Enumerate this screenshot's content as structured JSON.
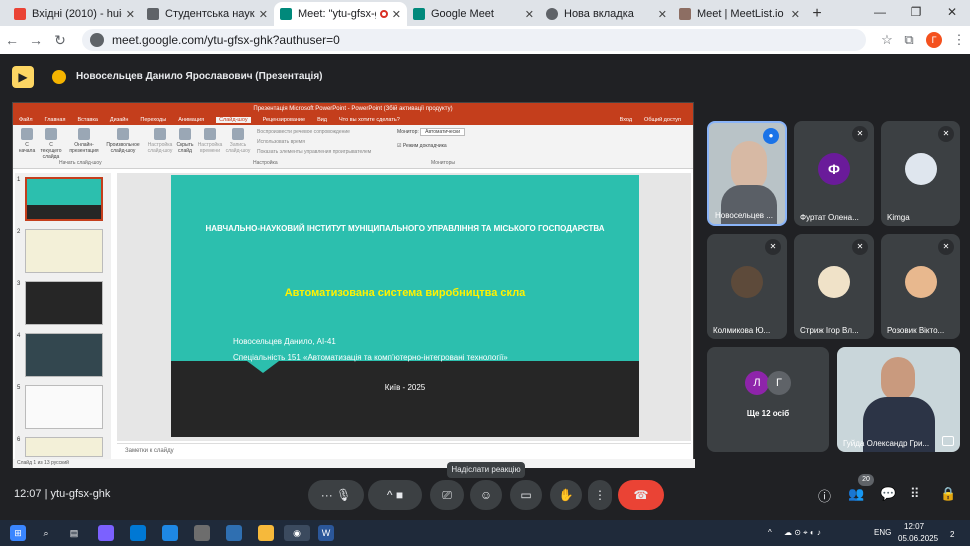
{
  "browser": {
    "tabs": [
      {
        "title": "Вхідні (2010) - huida.oleks",
        "color": "#ea4335",
        "active": false
      },
      {
        "title": "Студентська наукова конф",
        "color": "#5f6368",
        "active": false
      },
      {
        "title": "Meet: \"ytu-gfsx-ghk\"",
        "color": "#00897b",
        "active": true
      },
      {
        "title": "Google Meet",
        "color": "#00897b",
        "active": false
      },
      {
        "title": "Нова вкладка",
        "color": "#5f6368",
        "active": false
      },
      {
        "title": "Meet | MeetList.io",
        "color": "#8d6e63",
        "active": false
      }
    ],
    "url": "meet.google.com/ytu-gfsx-ghk?authuser=0",
    "profile_initial": "Г"
  },
  "meet": {
    "presenter": "Новосельцев Данило Ярославович (Презентація)",
    "meeting_code": "ytu-gfsx-ghk",
    "time": "12:07",
    "tooltip": "Надіслати реакцію",
    "participants_count": "20",
    "tiles": [
      {
        "name": "Новосельцев ...",
        "bg": "#a8b3b8",
        "muted": false
      },
      {
        "name": "Фуртат Олена...",
        "bg": "#3c4043",
        "muted": true,
        "initial": "Ф",
        "avatar_color": "#6a1b9a"
      },
      {
        "name": "Kimga",
        "bg": "#3c4043",
        "muted": true
      },
      {
        "name": "Колмикова Ю...",
        "bg": "#3c4043",
        "muted": true
      },
      {
        "name": "Стриж Ігор Вл...",
        "bg": "#3c4043",
        "muted": true
      },
      {
        "name": "Розовик Вікто...",
        "bg": "#3c4043",
        "muted": true
      }
    ],
    "others": {
      "label": "Ще 12 осіб",
      "initials": [
        "Л",
        "Г"
      ]
    },
    "last_tile_name": "Гуйда Олександр Гри..."
  },
  "ppt": {
    "window_title": "Презентація Microsoft PowerPoint - PowerPoint (Збій активації продукту)",
    "menu": [
      "Файл",
      "Главная",
      "Вставка",
      "Дизайн",
      "Переходы",
      "Анимация",
      "Слайд-шоу",
      "Рецензирование",
      "Вид",
      "Что вы хотите сделать?"
    ],
    "menu_right": [
      "Вход",
      "Общий доступ"
    ],
    "ribbon_buttons": [
      "С начала",
      "С текущего слайда",
      "Онлайн-презентация",
      "Произвольное слайд-шоу",
      "Настройка слайд-шоу",
      "Скрыть слайд",
      "Настройка времени",
      "Запись слайд-шоу"
    ],
    "ribbon_checks": [
      "Воспроизвести речевое сопровождение",
      "Использовать время",
      "Показать элементы управления проигрывателем"
    ],
    "ribbon_monitor": [
      "Монитор:",
      "Автоматически",
      "Режим докладчика"
    ],
    "groups": [
      "Начать слайд-шоу",
      "Настройка",
      "Мониторы"
    ],
    "slide": {
      "institute": "НАВЧАЛЬНО-НАУКОВИЙ ІНСТИТУТ МУНІЦИПАЛЬНОГО УПРАВЛІННЯ ТА МІСЬКОГО ГОСПОДАРСТВА",
      "title": "Автоматизована система виробництва скла",
      "author": "Новосельцев Данило, АІ-41",
      "specialty": "Спеціальність 151 «Автоматизація та комп’ютерно-інтегровані технології»",
      "city": "Київ - 2025"
    },
    "notes": "Заметки к слайду",
    "status": "Слайд 1 из 13    русский",
    "thumb_numbers": [
      "1",
      "2",
      "3",
      "4",
      "5",
      "6"
    ]
  },
  "taskbar": {
    "lang": "ENG",
    "time": "12:07",
    "date": "05.06.2025",
    "notif": "2"
  }
}
